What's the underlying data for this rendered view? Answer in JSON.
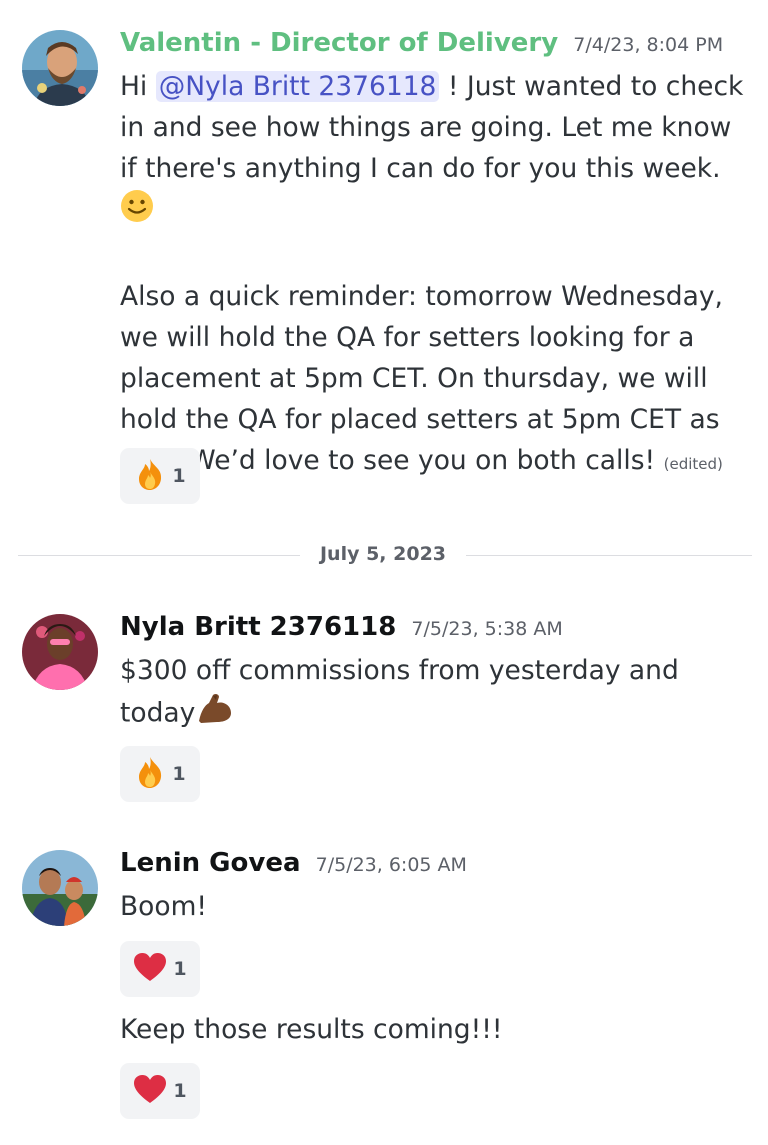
{
  "messages": [
    {
      "author": "Valentin - Director of Delivery",
      "timestamp": "7/4/23, 8:04 PM",
      "avatar_icon": "man-avatar",
      "text_pre": "Hi ",
      "mention": "@Nyla Britt 2376118",
      "text_p1": " ! Just wanted to check in and see how things are going. Let me know if there's anything I can do for you this week. ",
      "text_p1_emoji": "slightly-smiling-face-emoji",
      "text_p2": "Also a quick reminder: tomorrow Wednesday, we will hold the QA for setters looking for a placement at 5pm CET. On thursday, we will hold the QA for placed setters at 5pm CET as well. We’d love to see you on both calls!",
      "edited_label": "(edited)",
      "reaction": {
        "icon": "fire-emoji",
        "count": "1"
      }
    },
    {
      "author": "Nyla Britt 2376118",
      "timestamp": "7/5/23, 5:38 AM",
      "avatar_icon": "woman-avatar",
      "text": "$300 off commissions from yesterday and today",
      "text_emoji": "flexed-biceps-emoji",
      "reaction": {
        "icon": "fire-emoji",
        "count": "1"
      }
    },
    {
      "author": "Lenin Govea",
      "timestamp": "7/5/23, 6:05 AM",
      "avatar_icon": "man-avatar",
      "text": "Boom!",
      "reaction": {
        "icon": "red-heart-emoji",
        "count": "1"
      },
      "followup_text": "Keep those results coming!!!",
      "followup_reaction": {
        "icon": "red-heart-emoji",
        "count": "1"
      }
    }
  ],
  "date_divider": "July 5, 2023",
  "colors": {
    "author_highlight": "#5fbf80",
    "mention_bg": "#e6e8fd",
    "mention_text": "#4752c4",
    "reaction_bg": "#f2f3f5"
  }
}
